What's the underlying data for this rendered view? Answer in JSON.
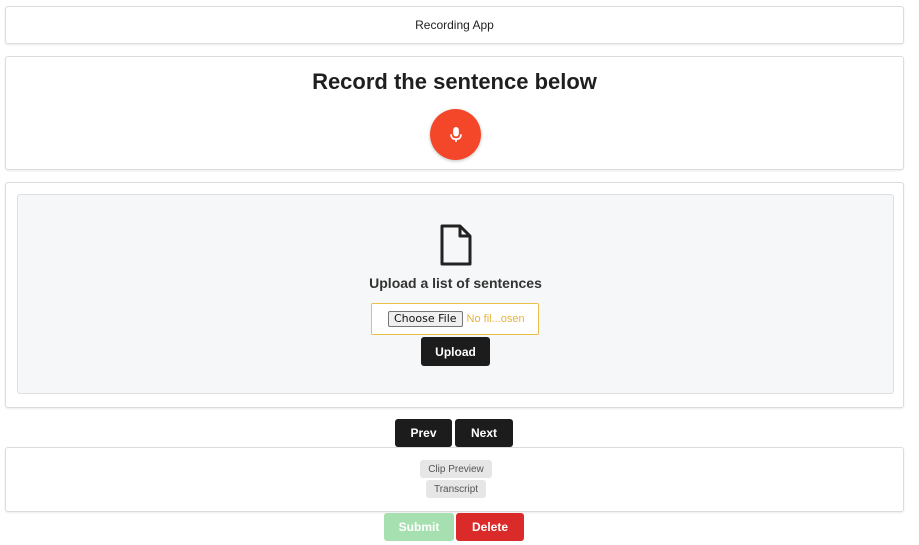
{
  "header": {
    "title": "Recording App"
  },
  "recorder": {
    "prompt_title": "Record the sentence below",
    "mic_icon": "microphone-icon",
    "mic_color": "#f44729"
  },
  "upload": {
    "icon": "file-icon",
    "title": "Upload a list of sentences",
    "choose_file_label": "Choose File",
    "file_status": "No fil...osen",
    "upload_label": "Upload"
  },
  "navigation": {
    "prev_label": "Prev",
    "next_label": "Next"
  },
  "preview": {
    "clip_preview_label": "Clip Preview",
    "transcript_label": "Transcript"
  },
  "actions": {
    "submit_label": "Submit",
    "submit_disabled": true,
    "delete_label": "Delete",
    "submit_color": "#a6e0b0",
    "delete_color": "#da2a2a"
  }
}
